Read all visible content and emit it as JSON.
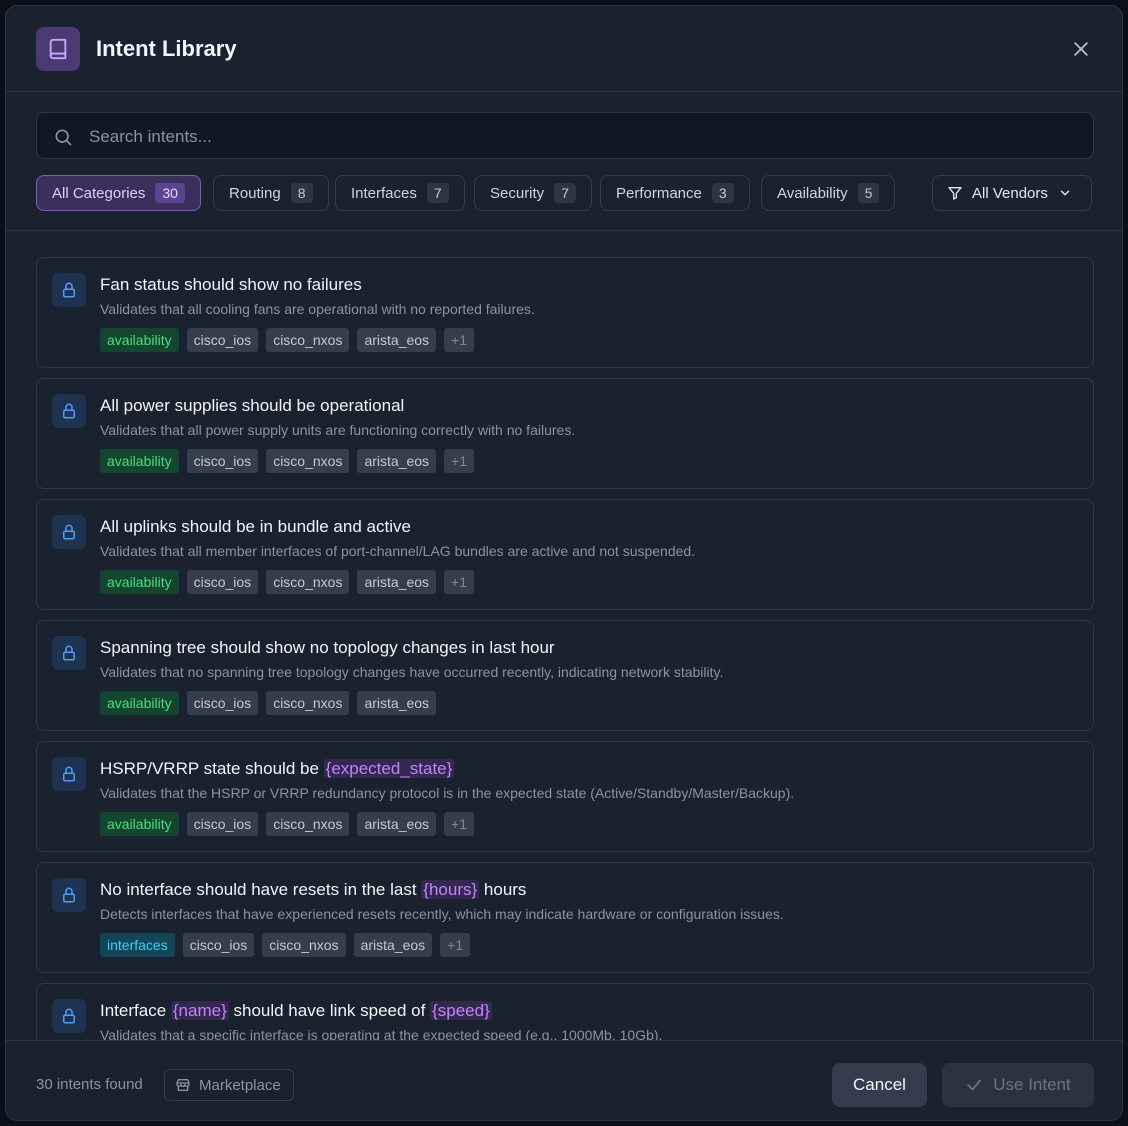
{
  "dialog": {
    "title": "Intent Library",
    "icon": "book-icon",
    "close_icon": "close-icon"
  },
  "search": {
    "placeholder": "Search intents...",
    "value": ""
  },
  "categories": [
    {
      "label": "All Categories",
      "count": "30",
      "active": true
    },
    {
      "label": "Routing",
      "count": "8",
      "active": false
    },
    {
      "label": "Interfaces",
      "count": "7",
      "active": false
    },
    {
      "label": "Security",
      "count": "7",
      "active": false
    },
    {
      "label": "Performance",
      "count": "3",
      "active": false
    },
    {
      "label": "Availability",
      "count": "5",
      "active": false
    }
  ],
  "vendor_filter": {
    "label": "All Vendors",
    "icon": "filter-icon"
  },
  "intents": [
    {
      "title": [
        {
          "t": "Fan status should show no failures"
        }
      ],
      "description": "Validates that all cooling fans are operational with no reported failures.",
      "category": "availability",
      "vendors": [
        "cisco_ios",
        "cisco_nxos",
        "arista_eos"
      ],
      "more": "+1"
    },
    {
      "title": [
        {
          "t": "All power supplies should be operational"
        }
      ],
      "description": "Validates that all power supply units are functioning correctly with no failures.",
      "category": "availability",
      "vendors": [
        "cisco_ios",
        "cisco_nxos",
        "arista_eos"
      ],
      "more": "+1"
    },
    {
      "title": [
        {
          "t": "All uplinks should be in bundle and active"
        }
      ],
      "description": "Validates that all member interfaces of port-channel/LAG bundles are active and not suspended.",
      "category": "availability",
      "vendors": [
        "cisco_ios",
        "cisco_nxos",
        "arista_eos"
      ],
      "more": "+1"
    },
    {
      "title": [
        {
          "t": "Spanning tree should show no topology changes in last hour"
        }
      ],
      "description": "Validates that no spanning tree topology changes have occurred recently, indicating network stability.",
      "category": "availability",
      "vendors": [
        "cisco_ios",
        "cisco_nxos",
        "arista_eos"
      ],
      "more": ""
    },
    {
      "title": [
        {
          "t": "HSRP/VRRP state should be "
        },
        {
          "v": "{expected_state}"
        }
      ],
      "description": "Validates that the HSRP or VRRP redundancy protocol is in the expected state (Active/Standby/Master/Backup).",
      "category": "availability",
      "vendors": [
        "cisco_ios",
        "cisco_nxos",
        "arista_eos"
      ],
      "more": "+1"
    },
    {
      "title": [
        {
          "t": "No interface should have resets in the last "
        },
        {
          "v": "{hours}"
        },
        {
          "t": " hours"
        }
      ],
      "description": "Detects interfaces that have experienced resets recently, which may indicate hardware or configuration issues.",
      "category": "interfaces",
      "vendors": [
        "cisco_ios",
        "cisco_nxos",
        "arista_eos"
      ],
      "more": "+1"
    },
    {
      "title": [
        {
          "t": "Interface "
        },
        {
          "v": "{name}"
        },
        {
          "t": " should have link speed of "
        },
        {
          "v": "{speed}"
        }
      ],
      "description": "Validates that a specific interface is operating at the expected speed (e.g., 1000Mb, 10Gb).",
      "category": "interfaces",
      "vendors": [],
      "more": ""
    }
  ],
  "footer": {
    "found_text": "30 intents found",
    "marketplace_label": "Marketplace",
    "marketplace_icon": "store-icon",
    "cancel_label": "Cancel",
    "use_label": "Use Intent",
    "use_icon": "check-icon"
  },
  "colors": {
    "accent": "#7c5bb8",
    "availability": "#4ade80",
    "interfaces": "#38d3ee",
    "variable": "#c084fc"
  }
}
